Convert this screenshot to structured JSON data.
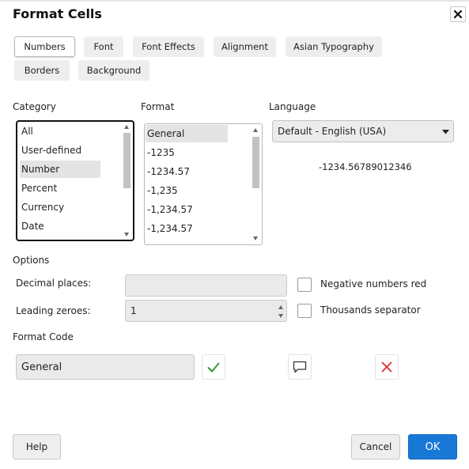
{
  "dialog": {
    "title": "Format Cells"
  },
  "tabs": [
    {
      "label": "Numbers"
    },
    {
      "label": "Font"
    },
    {
      "label": "Font Effects"
    },
    {
      "label": "Alignment"
    },
    {
      "label": "Asian Typography"
    },
    {
      "label": "Borders"
    },
    {
      "label": "Background"
    }
  ],
  "category": {
    "label": "Category",
    "items": [
      "All",
      "User-defined",
      "Number",
      "Percent",
      "Currency",
      "Date"
    ],
    "selected": "Number"
  },
  "format": {
    "label": "Format",
    "items": [
      "General",
      "-1235",
      "-1234.57",
      "-1,235",
      "-1,234.57",
      "-1,234.57"
    ],
    "selected": "General"
  },
  "language": {
    "label": "Language",
    "value": "Default - English (USA)",
    "preview": "-1234.56789012346"
  },
  "options": {
    "label": "Options",
    "decimal_places_label": "Decimal places:",
    "decimal_places_value": "",
    "leading_zeroes_label": "Leading zeroes:",
    "leading_zeroes_value": "1",
    "negative_red_label": "Negative numbers red",
    "negative_red_checked": false,
    "thousands_label": "Thousands separator",
    "thousands_checked": false
  },
  "format_code": {
    "label": "Format Code",
    "value": "General"
  },
  "buttons": {
    "help": "Help",
    "cancel": "Cancel",
    "ok": "OK"
  },
  "colors": {
    "accent": "#1878d6",
    "ok_check": "#2e9a3a",
    "delete_x": "#d9302c"
  }
}
